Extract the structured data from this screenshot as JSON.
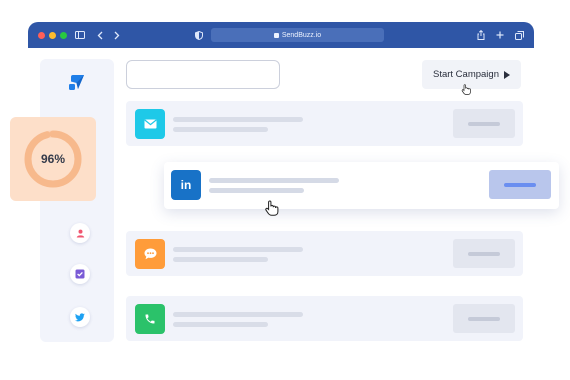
{
  "browser": {
    "url": "SendBuzz.io",
    "icons": [
      "sidebar-toggle-icon",
      "back-icon",
      "forward-icon",
      "shield-icon",
      "share-icon",
      "new-tab-icon",
      "tabs-icon"
    ]
  },
  "app": {
    "progress": {
      "value": 96,
      "label": "96%",
      "color": "#f7b98c"
    },
    "search": {
      "value": "",
      "placeholder": ""
    },
    "start_button": {
      "label": "Start Campaign",
      "icon": "play-icon"
    },
    "sidebar": {
      "logo_icon": "sendbuzz-logo-icon",
      "items": [
        {
          "name": "contacts",
          "icon": "user-icon",
          "color": "#f0566f"
        },
        {
          "name": "tasks",
          "icon": "checkbox-icon",
          "color": "#7a5bd6"
        },
        {
          "name": "twitter",
          "icon": "twitter-icon",
          "color": "#1da1f2"
        }
      ]
    },
    "channels": [
      {
        "name": "email",
        "icon": "mail-icon",
        "color": "#1ec9e8",
        "active": false
      },
      {
        "name": "linkedin",
        "icon": "linkedin-icon",
        "icon_text": "in",
        "color": "#1872c7",
        "active": true
      },
      {
        "name": "chat",
        "icon": "chat-bubble-icon",
        "color": "#ff9c3a",
        "active": false
      },
      {
        "name": "phone",
        "icon": "phone-icon",
        "color": "#2bc26a",
        "active": false
      }
    ]
  }
}
